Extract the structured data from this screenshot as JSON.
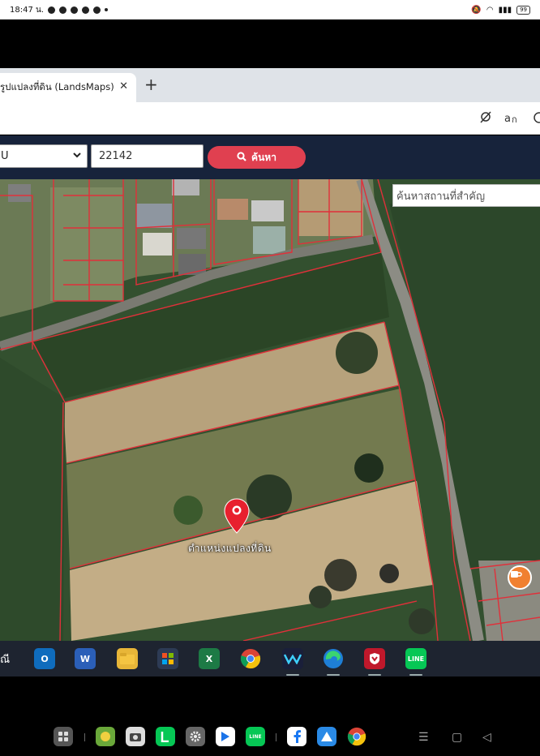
{
  "status_bar": {
    "time": "18:47 น.",
    "battery": "99"
  },
  "browser": {
    "tab_title": "รูปแปลงที่ดิน (LandsMaps)",
    "tab_close": "✕",
    "new_tab": "+"
  },
  "site": {
    "select_value": "U",
    "parcel_input_value": "22142",
    "search_button_label": "ค้นหา"
  },
  "map": {
    "poi_search_placeholder": "ค้นหาสถานที่สำคัญ",
    "pin_label": "ตำแหน่งแปลงที่ดิน"
  },
  "taskbar": {
    "text": "ณี"
  },
  "colors": {
    "site_bar": "#17233b",
    "search_button": "#e04050",
    "parcel_line": "#e0303a",
    "pin": "#e8202e",
    "taskbar": "#1e2430"
  }
}
